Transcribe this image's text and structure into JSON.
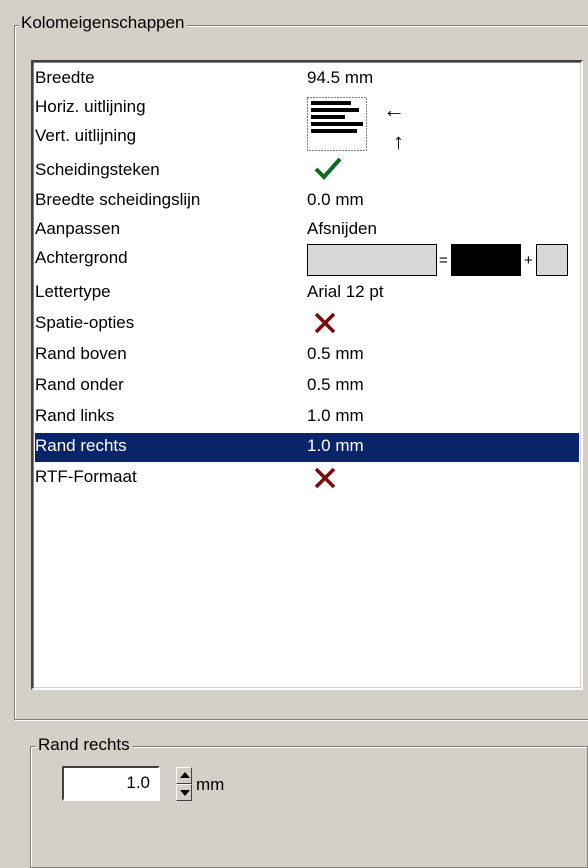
{
  "column_properties": {
    "title": "Kolomeigenschappen",
    "rows": [
      {
        "label": "Breedte",
        "value": "94.5 mm"
      },
      {
        "label": "Horiz. uitlijning",
        "value": ""
      },
      {
        "label": "Vert. uitlijning",
        "value": ""
      },
      {
        "label": "Scheidingsteken",
        "value": ""
      },
      {
        "label": "Breedte scheidingslijn",
        "value": "0.0 mm"
      },
      {
        "label": "Aanpassen",
        "value": "Afsnijden"
      },
      {
        "label": "Achtergrond",
        "value": ""
      },
      {
        "label": "Lettertype",
        "value": "Arial 12 pt"
      },
      {
        "label": "Spatie-opties",
        "value": ""
      },
      {
        "label": "Rand boven",
        "value": "0.5 mm"
      },
      {
        "label": "Rand onder",
        "value": "0.5 mm"
      },
      {
        "label": "Rand links",
        "value": "1.0 mm"
      },
      {
        "label": "Rand rechts",
        "value": "1.0 mm"
      },
      {
        "label": "RTF-Formaat",
        "value": ""
      }
    ],
    "selected_row": "Rand rechts",
    "horiz_arrow": "←",
    "vert_arrow": "↑",
    "separator_icon": "checkmark-icon",
    "spacing_icon": "cross-icon",
    "rtf_icon": "cross-icon",
    "background_colors": {
      "base": "#d8d8d8",
      "overlay": "#000000",
      "result": "#d8d8d8"
    },
    "background_ops": {
      "eq": "=",
      "plus": "+"
    },
    "check_color": "#0b6b1f",
    "cross_color": "#7a0a0a",
    "selection_color": "#0a246a"
  },
  "right_border": {
    "title": "Rand rechts",
    "value": "1.0",
    "unit": "mm"
  }
}
